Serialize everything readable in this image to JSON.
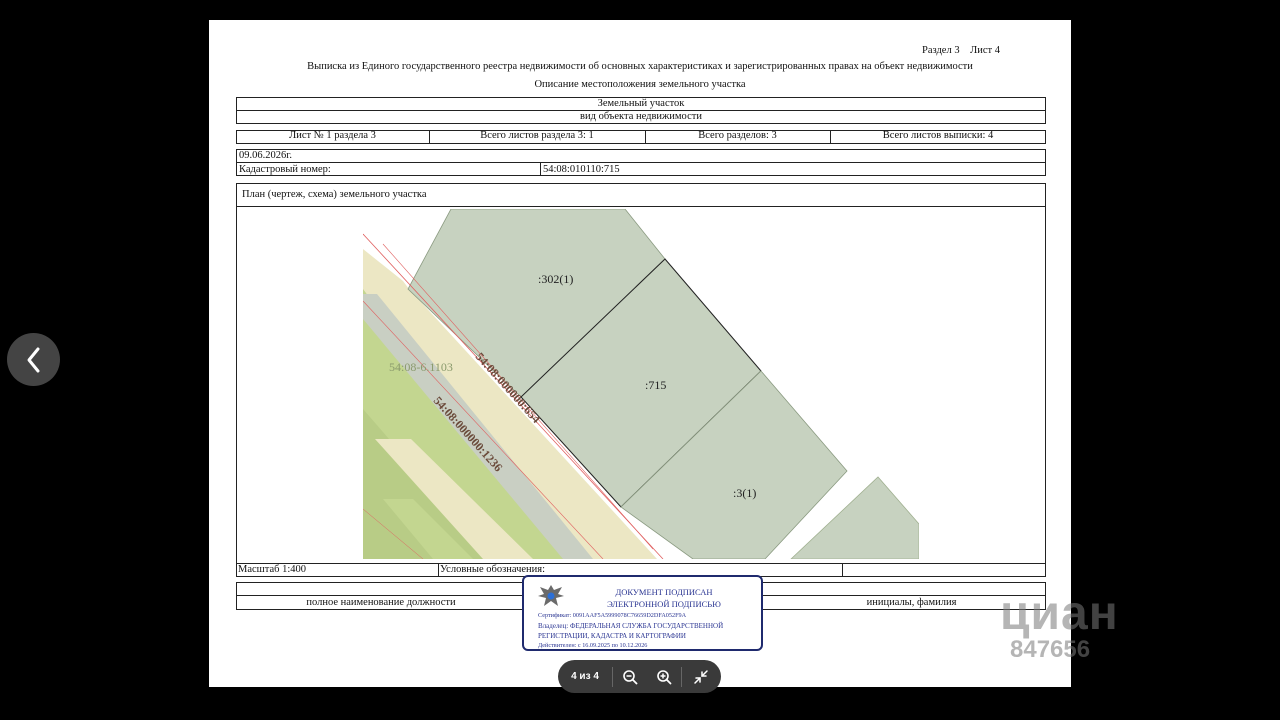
{
  "viewer": {
    "page_indicator": "4 из 4",
    "icons": {
      "prev": "chevron-left-icon",
      "zoom_out": "zoom-out-icon",
      "zoom_in": "zoom-in-icon",
      "exit_fullscreen": "exit-fullscreen-icon"
    }
  },
  "document": {
    "header_right": "Раздел 3    Лист 4",
    "title": "Выписка из Единого государственного реестра недвижимости об основных характеристиках и зарегистрированных правах на объект недвижимости",
    "subtitle": "Описание местоположения земельного участка",
    "object_type": "Земельный участок",
    "object_type_caption": "вид объекта недвижимости",
    "sheet_info": {
      "sheet": "Лист № 1 раздела 3",
      "section_sheets": "Всего листов раздела 3: 1",
      "sections": "Всего разделов: 3",
      "total_sheets": "Всего листов выписки: 4"
    },
    "date": "09.06.2026г.",
    "cadastral_label": "Кадастровый номер:",
    "cadastral_number": "54:08:010110:715",
    "plan_title": "План (чертеж, схема) земельного участка",
    "scale": "Масштаб 1:400",
    "legend_label": "Условные обозначения:",
    "position_caption": "полное наименование должности",
    "name_caption": "инициалы, фамилия"
  },
  "map": {
    "parcels": {
      "p302": ":302(1)",
      "p715": ":715",
      "p3": ":3(1)",
      "p1103": "54:08-6.1103",
      "p654": "54:08:000000:654",
      "p1236": "54:08:000000:1236"
    },
    "colors": {
      "parcel_fill": "#c7d2c0",
      "road_fill": "#ece7c4",
      "green_fill": "#c3d690",
      "boundary_red": "#e06060"
    }
  },
  "stamp": {
    "line1": "ДОКУМЕНТ ПОДПИСАН",
    "line2": "ЭЛЕКТРОННОЙ ПОДПИСЬЮ",
    "cert": "Сертификат: 0091AAF5A5999078C76659D2DFA052F9A",
    "owner1": "Владелец: ФЕДЕРАЛЬНАЯ СЛУЖБА ГОСУДАРСТВЕННОЙ",
    "owner2": "РЕГИСТРАЦИИ, КАДАСТРА И КАРТОГРАФИИ",
    "valid": "Действителен: с 16.09.2025 по 10.12.2026",
    "emblem": "eagle-emblem-icon"
  },
  "watermark": {
    "brand": "циан",
    "number": "847656"
  }
}
